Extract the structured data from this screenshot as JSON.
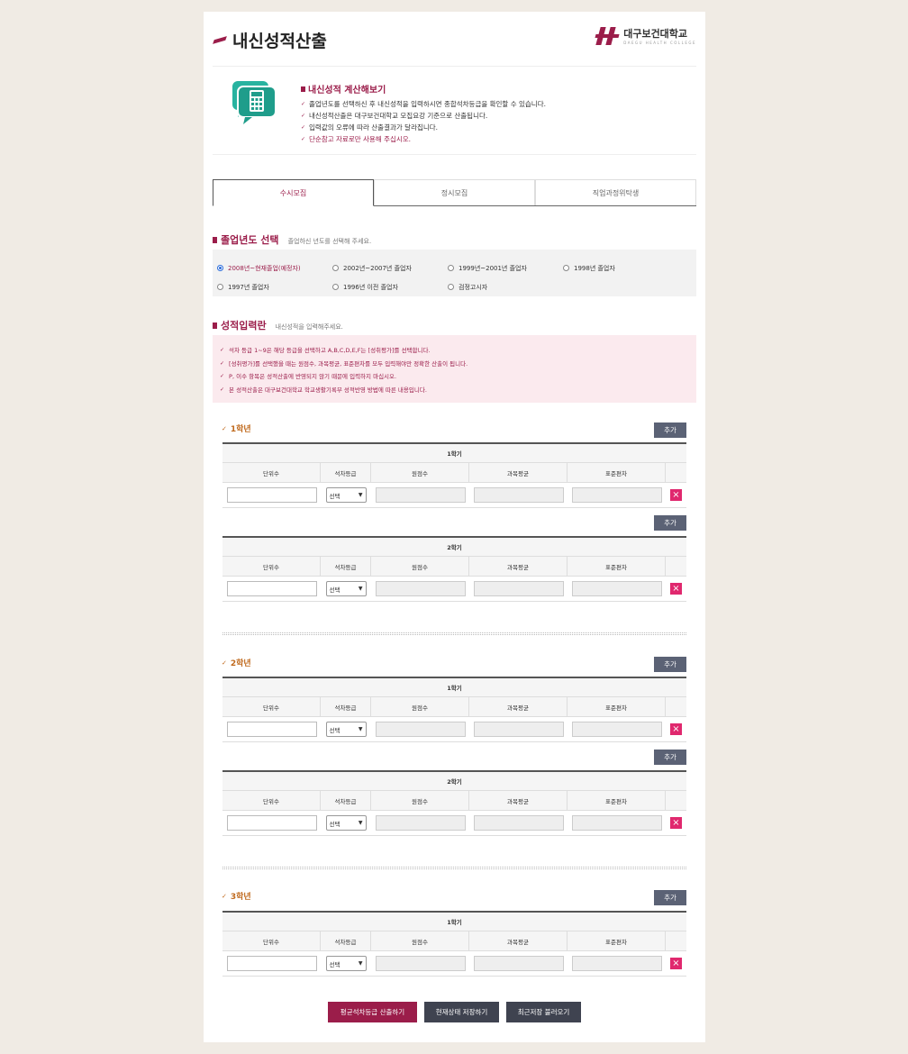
{
  "header": {
    "title": "내신성적산출",
    "logo_name": "대구보건대학교",
    "logo_sub": "DAEGU HEALTH COLLEGE"
  },
  "intro": {
    "title": "내신성적 계산해보기",
    "lines": [
      "졸업년도를 선택하신 후 내신성적을 입력하시면 종합석차등급을 확인할 수 있습니다.",
      "내신성적산출은 대구보건대학교 모집요강 기준으로 산출됩니다.",
      "입력값의 오류에 따라 산출결과가 달라집니다.",
      "단순참고 자료로만 사용해 주십시오."
    ]
  },
  "tabs": [
    "수시모집",
    "정시모집",
    "직업과정위탁생"
  ],
  "graduation": {
    "title": "졸업년도 선택",
    "desc": "졸업하신 년도를 선택해 주세요.",
    "options": [
      "2008년~현재졸업(예정자)",
      "2002년~2007년 졸업자",
      "1999년~2001년 졸업자",
      "1998년 졸업자",
      "1997년 졸업자",
      "1996년 이전 졸업자",
      "검정고시자"
    ]
  },
  "grades": {
    "title": "성적입력란",
    "desc": "내신성적을 입력해주세요.",
    "notices": [
      "석차 등급 1~9은 해당 등급을 선택하고 A,B,C,D,E,F는 [성취평가]를 선택합니다.",
      "[성취평가]를 선택했을 때는 원점수, 과목평균, 표준편차를 모두 입력해야만 정확한 산출이 됩니다.",
      "P, 이수 항목은 성적산출에 반영되지 않기 때문에 입력하지 마십시오.",
      "본 성적산출은 대구보건대학교 학교생활기록부 성적반영 방법에 따른 내용입니다."
    ]
  },
  "years": [
    "1학년",
    "2학년",
    "3학년"
  ],
  "semesters": [
    "1학기",
    "2학기"
  ],
  "columns": [
    "단위수",
    "석차등급",
    "원점수",
    "과목평균",
    "표준편차"
  ],
  "add_label": "추가",
  "select_label": "선택",
  "buttons": {
    "calc": "평균석차등급 산출하기",
    "save": "현재상태 저장하기",
    "load": "최근저장 불러오기"
  }
}
